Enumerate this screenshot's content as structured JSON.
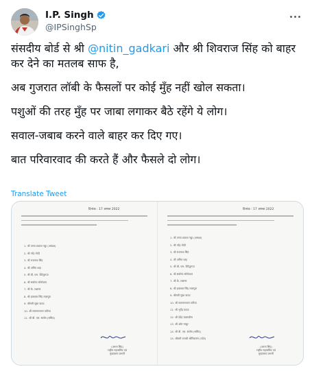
{
  "author": {
    "display_name": "I.P. Singh",
    "handle": "@IPSinghSp",
    "avatar_icon": "profile-photo",
    "verified_icon": "verified-badge-icon",
    "verified_color": "#1d9bf0"
  },
  "more_icon": "more-options-icon",
  "tweet": {
    "p1_before": "संसदीय बोर्ड से श्री ",
    "p1_mention": "@nitin_gadkari",
    "p1_after": " और श्री शिवराज सिंह को बाहर कर देने का मतलब साफ है,",
    "p2": "अब गुजरात लॉबी के फैसलों पर कोई मुँह नहीं खोल सकता।",
    "p3": "पशुओं की तरह मुँह पर जाबा लगाकर बैठे रहेंगे ये लोग।",
    "p4": "सवाल-जबाब करने वाले बाहर कर दिए गए।",
    "p5": "बात परिवारवाद की करते हैं और फैसले दो लोग।"
  },
  "translate_label": "Translate Tweet",
  "link_color": "#1d9bf0",
  "media": {
    "left_page": {
      "date": "दिनांक : 17 अगस्त 2022",
      "members": [
        "1. श्री जगत प्रकाश नड्डा (अध्यक्ष)",
        "2. श्री नरेंद्र मोदी",
        "3. श्री राजनाथ सिंह",
        "4. श्री अमित शाह",
        "5. श्री बी. एस. येदियुरप्पा",
        "6. श्री सर्बानंद सोनोवाल",
        "7. श्री के. लक्ष्मण",
        "8. श्री इकबाल सिंह लालपुरा",
        "9. श्रीमती सुधा यादव",
        "10. श्री सत्यनारायण जटिया",
        "11. श्री बी. एल. संतोष (सचिव)"
      ],
      "signature_name": "(अरुण सिंह)",
      "signature_title": "राष्ट्रीय महासचिव एवं",
      "signature_office": "मुख्यालय प्रभारी"
    },
    "right_page": {
      "date": "दिनांक : 17 अगस्त 2022",
      "members": [
        "1. श्री जगत प्रकाश नड्डा (अध्यक्ष)",
        "2. श्री नरेंद्र मोदी",
        "3. श्री राजनाथ सिंह",
        "4. श्री अमित शाह",
        "5. श्री बी. एस. येदियुरप्पा",
        "6. श्री सर्बानंद सोनोवाल",
        "7. श्री के. लक्ष्मण",
        "8. श्री इकबाल सिंह लालपुरा",
        "9. श्रीमती सुधा यादव",
        "10. श्री सत्यनारायण जटिया",
        "11. श्री भूपेंद्र यादव",
        "12. श्री देवेंद्र फडणवीस",
        "13. श्री ओम माथुर",
        "14. श्री बी. एल. संतोष (सचिव)",
        "15. श्रीमती वनाथी श्रीनिवासन (पदेन)"
      ],
      "signature_name": "(अरुण सिंह)",
      "signature_title": "राष्ट्रीय महासचिव एवं",
      "signature_office": "मुख्यालय प्रभारी"
    }
  }
}
